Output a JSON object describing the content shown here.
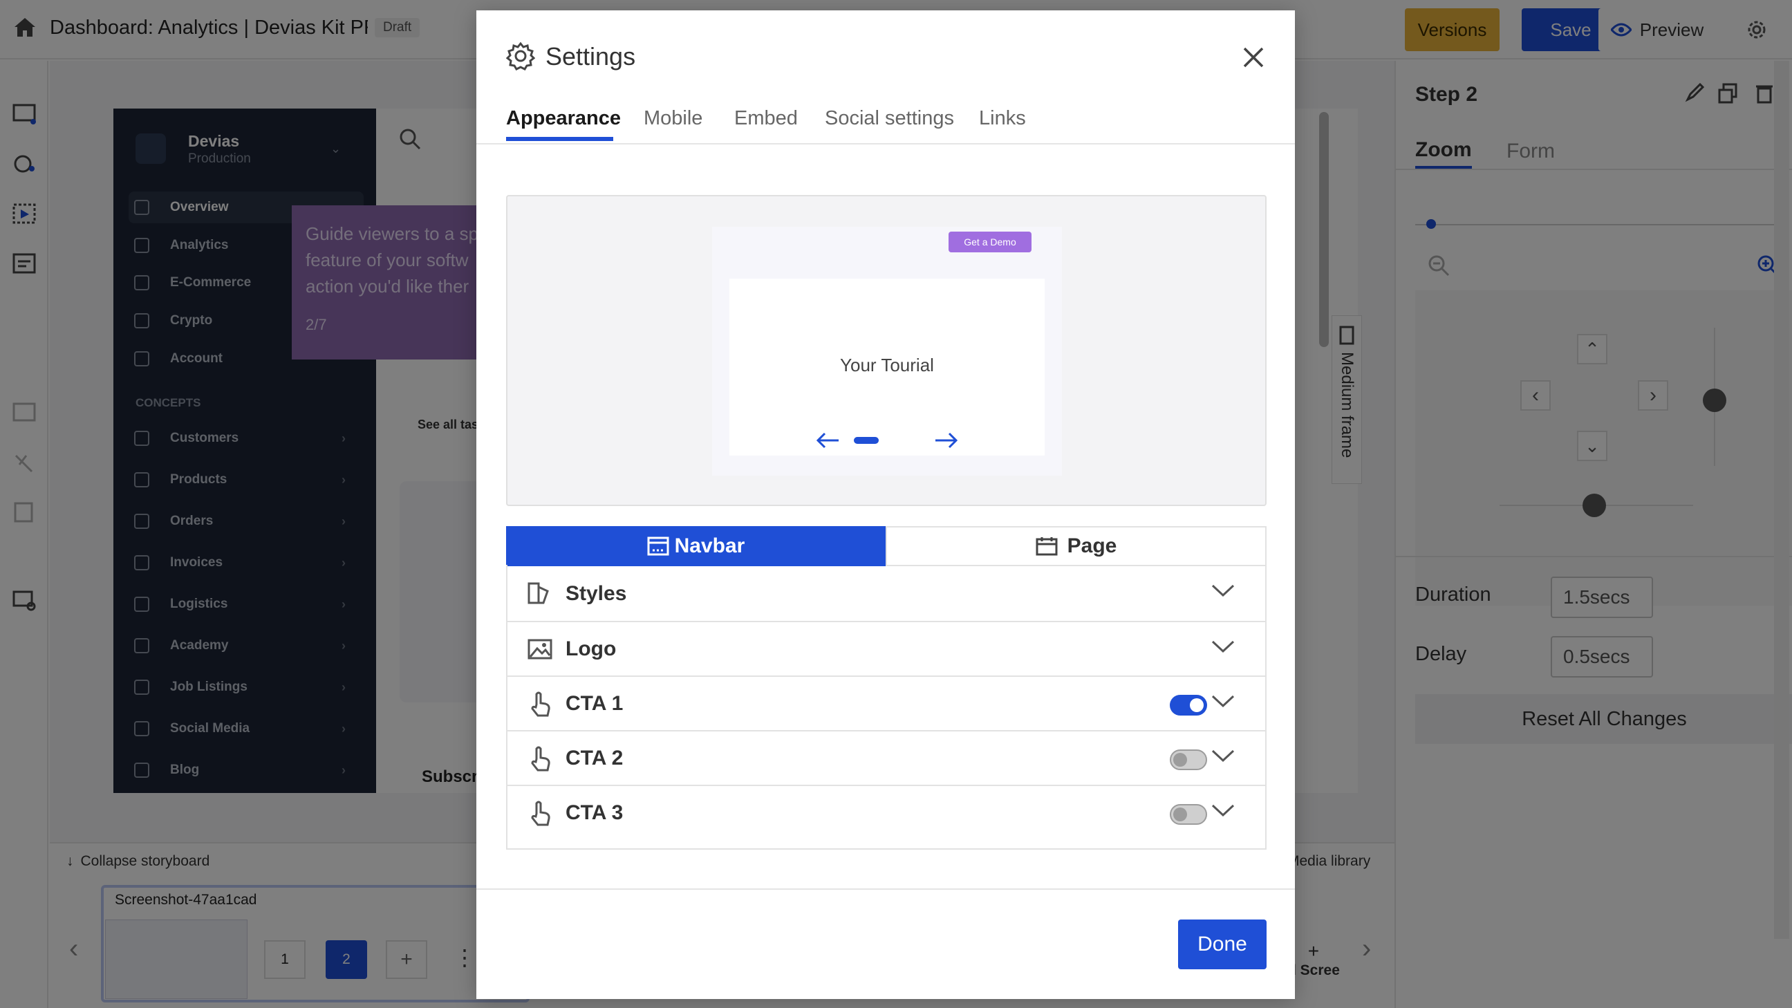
{
  "app": {
    "title": "Dashboard: Analytics | Devias Kit PR",
    "badge": "Draft",
    "versions_label": "Versions",
    "save_label": "Save",
    "preview_label": "Preview"
  },
  "canvas": {
    "brand_name": "Devias",
    "brand_sub": "Production",
    "nav_items": [
      "Overview",
      "Analytics",
      "E-Commerce",
      "Crypto",
      "Account"
    ],
    "section_label": "CONCEPTS",
    "concept_items": [
      "Customers",
      "Products",
      "Orders",
      "Invoices",
      "Logistics",
      "Academy",
      "Job Listings",
      "Social Media",
      "Blog"
    ],
    "tooltip_text": "Guide viewers to a sp feature of your softw action you'd like ther",
    "tooltip_step": "2/7",
    "see_all": "See all tas",
    "subscr": "Subscr",
    "medium_frame": "Medium frame"
  },
  "storyboard": {
    "collapse_label": "Collapse storyboard",
    "media_library": "Media library",
    "screenshot_name": "Screenshot-47aa1cad",
    "step_numbers": [
      "1",
      "2"
    ],
    "add_screen": "d Scree"
  },
  "right_panel": {
    "step_title": "Step 2",
    "tabs": [
      "Zoom",
      "Form"
    ],
    "duration_label": "Duration",
    "duration_value": "1.5secs",
    "delay_label": "Delay",
    "delay_value": "0.5secs",
    "reset_label": "Reset All Changes"
  },
  "modal": {
    "title": "Settings",
    "tabs": [
      "Appearance",
      "Mobile",
      "Embed",
      "Social settings",
      "Links"
    ],
    "preview": {
      "cta_label": "Get a Demo",
      "body_text": "Your Tourial"
    },
    "segments": [
      "Navbar",
      "Page"
    ],
    "rows": [
      {
        "label": "Styles"
      },
      {
        "label": "Logo"
      },
      {
        "label": "CTA 1",
        "toggle": true
      },
      {
        "label": "CTA 2",
        "toggle": false
      },
      {
        "label": "CTA 3",
        "toggle": false
      }
    ],
    "done_label": "Done"
  },
  "colors": {
    "primary": "#1f4fd6",
    "versions": "#e8b23a",
    "tooltip": "#8e6ab1",
    "sidebar": "#1c2536"
  }
}
